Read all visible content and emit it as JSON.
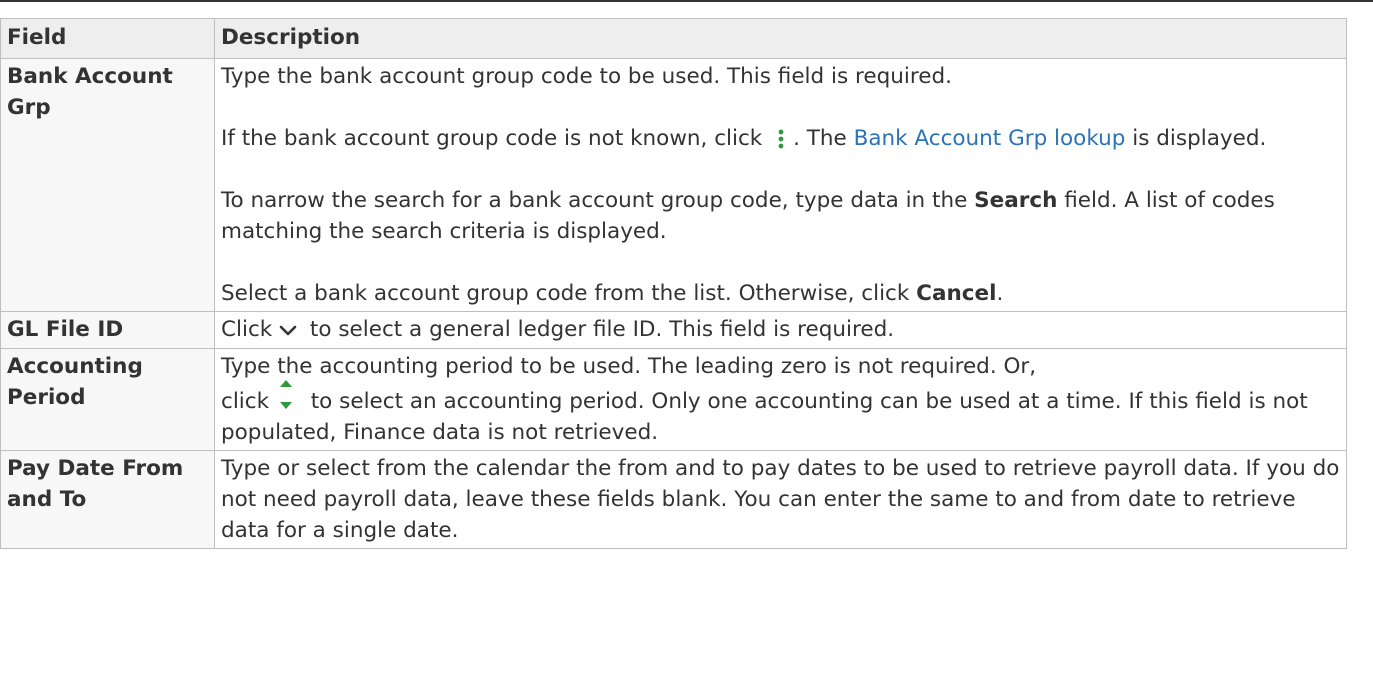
{
  "table": {
    "headers": {
      "field": "Field",
      "description": "Description"
    },
    "rows": [
      {
        "field": "Bank Account Grp",
        "p1": "Type the bank account group code to be used. This field is required.",
        "p2_a": "If the bank account group code is not known, click",
        "p2_b": ". The",
        "p2_link": "Bank Account Grp lookup",
        "p2_c": "is displayed.",
        "p3_a": "To narrow the search for a bank account group code, type data in the",
        "p3_bold": "Search",
        "p3_b": "field. A list of codes matching the search criteria is displayed.",
        "p4_a": "Select a bank account group code from the list. Otherwise, click",
        "p4_bold": "Cancel",
        "p4_b": "."
      },
      {
        "field": "GL File ID",
        "a": "Click",
        "b": "to select a general ledger file ID. This field is required."
      },
      {
        "field": "Accounting Period",
        "a": "Type the accounting period to be used. The leading zero is not required. Or,",
        "b": "click",
        "c": "to select an accounting period. Only one accounting can be used at a time. If this field is not populated, Finance data is not retrieved."
      },
      {
        "field": "Pay Date From and To",
        "text": "Type or select from the calendar the from and to pay dates to be used to retrieve payroll data. If you do not need payroll data, leave these fields blank. You can enter the same to and from date to retrieve data for a single date."
      }
    ]
  },
  "icons": {
    "lookup": "kebab-vertical-icon",
    "dropdown": "chevron-down-icon",
    "spinner": "up-down-spinner-icon"
  },
  "colors": {
    "link": "#2b73b7",
    "icon_green": "#2e9a3c",
    "text": "#333333",
    "header_bg": "#eeeeee"
  }
}
